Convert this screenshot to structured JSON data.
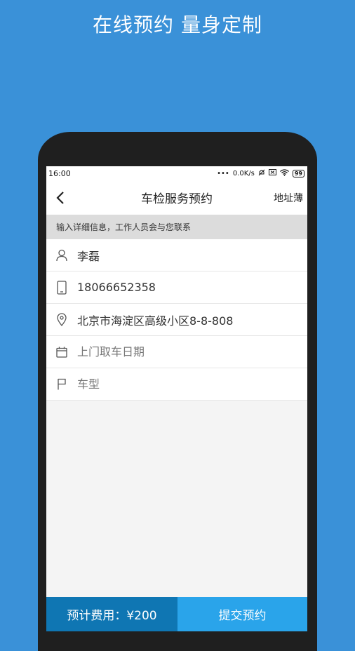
{
  "promo": {
    "headline": "在线预约 量身定制"
  },
  "status_bar": {
    "time": "16:00",
    "network_speed": "0.0K/s",
    "battery": "99"
  },
  "nav": {
    "title": "车检服务预约",
    "address_book": "地址薄"
  },
  "hint": "输入详细信息，工作人员会与您联系",
  "form": {
    "name": {
      "value": "李磊",
      "icon": "person-icon"
    },
    "phone": {
      "value": "18066652358",
      "icon": "phone-icon"
    },
    "address": {
      "value": "北京市海淀区高级小区8-8-808",
      "icon": "location-pin-icon"
    },
    "pickup_date": {
      "value": "",
      "placeholder": "上门取车日期",
      "icon": "calendar-icon"
    },
    "car_model": {
      "value": "",
      "placeholder": "车型",
      "icon": "flag-icon"
    }
  },
  "footer": {
    "estimated_cost": "预计费用：¥200",
    "submit": "提交预约"
  },
  "colors": {
    "background": "#3a91d8",
    "cost_bg": "#0f76b3",
    "submit_bg": "#2aa4ea"
  }
}
